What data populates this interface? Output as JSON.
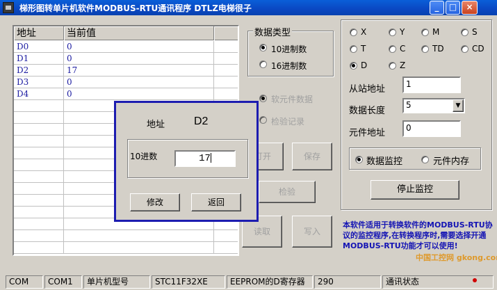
{
  "window": {
    "title": "梯形图转单片机软件MODBUS-RTU通讯程序 DTLZ电梯很子",
    "min_label": "_",
    "max_label": "□",
    "close_label": "×"
  },
  "grid": {
    "headers": [
      "地址",
      "当前值"
    ],
    "rows": [
      {
        "addr": "D0",
        "value": "0"
      },
      {
        "addr": "D1",
        "value": "0"
      },
      {
        "addr": "D2",
        "value": "17"
      },
      {
        "addr": "D3",
        "value": "0"
      },
      {
        "addr": "D4",
        "value": "0"
      }
    ]
  },
  "data_type": {
    "title": "数据类型",
    "options": [
      "10进制数",
      "16进制数"
    ],
    "selected": "10进制数"
  },
  "source": {
    "options": [
      "软元件数据",
      "检验记录"
    ]
  },
  "mid_buttons": {
    "open": "打开",
    "save": "保存",
    "check": "检验",
    "read": "读取",
    "write": "写入"
  },
  "device_types": [
    "X",
    "Y",
    "M",
    "S",
    "T",
    "C",
    "TD",
    "CD",
    "D",
    "Z"
  ],
  "selected_device": "D",
  "fields": {
    "slave_label": "从站地址",
    "slave_value": "1",
    "length_label": "数据长度",
    "length_value": "5",
    "element_label": "元件地址",
    "element_value": "0"
  },
  "monitor": {
    "options": [
      "数据监控",
      "元件内存"
    ],
    "selected": "数据监控",
    "stop_button": "停止监控"
  },
  "info_text": "本软件适用于转换软件的MODBUS-RTU协议的监控程序,在转换程序时,需要选择开通MODBUS-RTU功能才可以使用!",
  "dialog": {
    "addr_label": "地址",
    "addr_value": "D2",
    "group_label": "10进数",
    "input_value": "17",
    "modify_button": "修改",
    "back_button": "返回"
  },
  "status_bar": [
    "COM",
    "COM1",
    "单片机型号",
    "STC11F32XE",
    "EEPROM的D寄存器",
    "290",
    "通讯状态"
  ],
  "watermark": "中国工控网 gkong.com",
  "colors": {
    "dialog_border": "#1c1cb0",
    "info_text": "#1414b4",
    "grid_text": "#1a1aa0"
  }
}
